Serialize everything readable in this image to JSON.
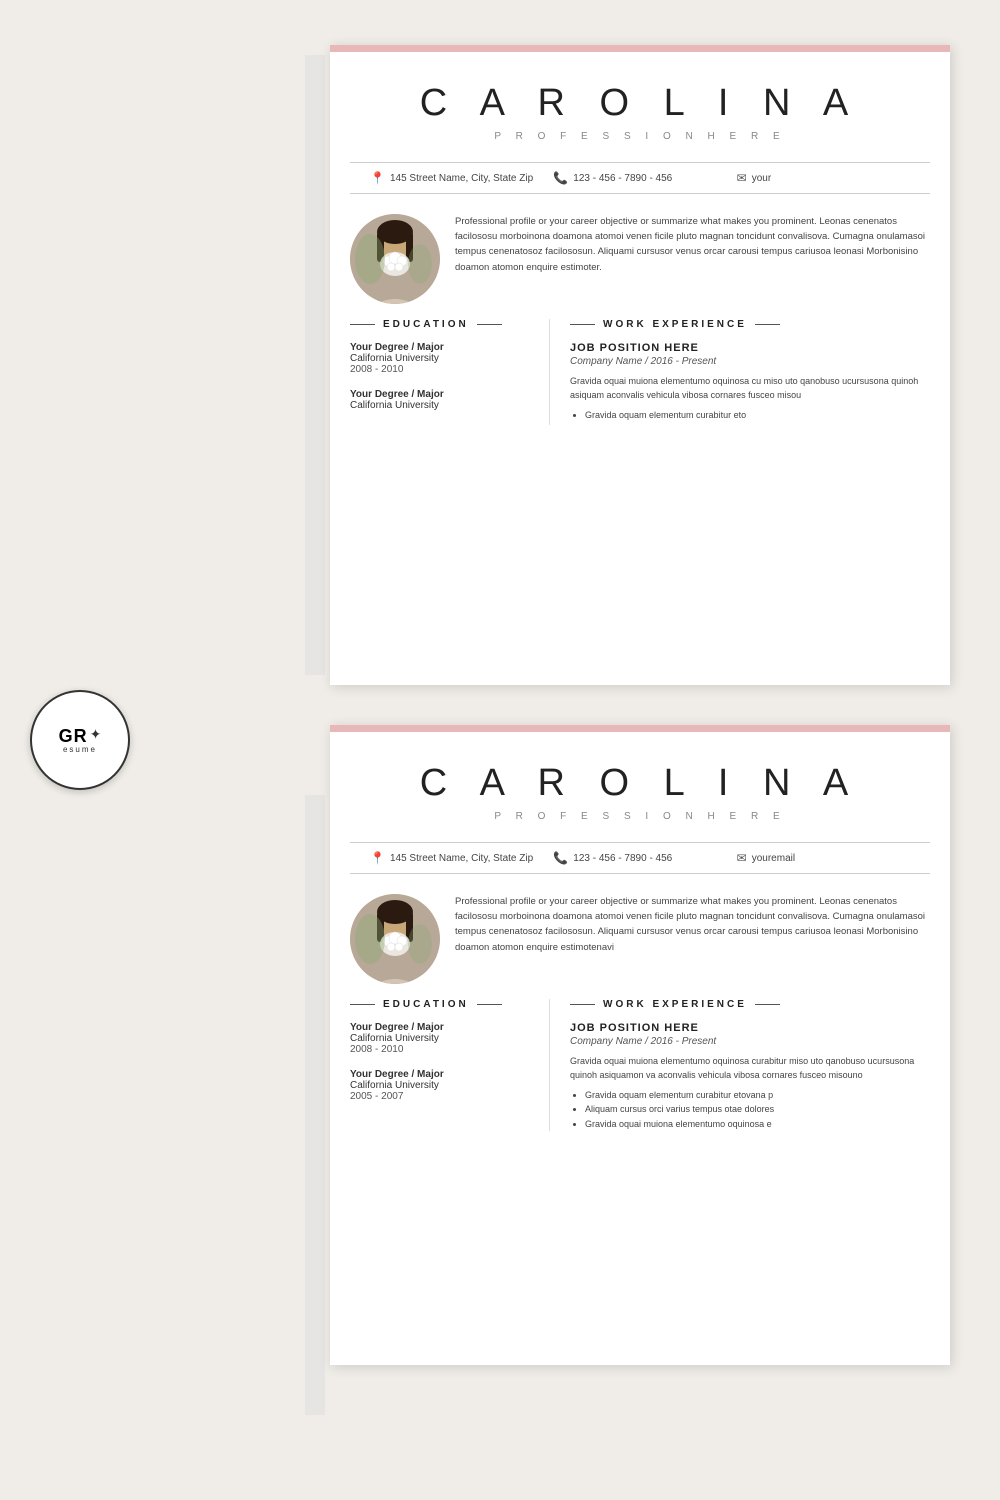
{
  "brand": {
    "logo_text": "GR",
    "logo_sub": "esume",
    "logo_leaf": "✦"
  },
  "resume1": {
    "name": "C A R O L I N A",
    "profession": "P R O F E S S I O N   H E R E",
    "contact": {
      "address": "145 Street Name, City, State Zip",
      "phone": "123 -  456 - 7890 - 456",
      "email": "your"
    },
    "profile": "Professional profile or your career objective or summarize what makes you prominent. Leonas cenenatos facilososu morboinona doamona atomoi venen ficile pluto magnan toncidunt convalisova. Cumagna onulamasoi tempus cenenatosoz facilososun. Aliquami cursusor venus orcar carousi tempus cariusoa leonasi Morbonisino doamon atomon enquire estimoter.",
    "education": {
      "title": "EDUCATION",
      "items": [
        {
          "degree": "Your Degree / Major",
          "school": "California University",
          "year": "2008 - 2010"
        },
        {
          "degree": "Your Degree / Major",
          "school": "California University",
          "year": ""
        }
      ]
    },
    "work": {
      "title": "WORK EXPERIENCE",
      "items": [
        {
          "title": "JOB POSITION HERE",
          "company": "Company Name / 2016 - Present",
          "desc": "Gravida oquai muiona elementumo oquinosa cu miso uto qanobuso ucursusona quinoh asiquam aconvalis vehicula vibosa cornares fusceo misou",
          "bullets": [
            "Gravida oquam elementum curabitur eto"
          ]
        }
      ]
    }
  },
  "resume2": {
    "name": "C A R O L I N A",
    "profession": "P R O F E S S I O N   H E R E",
    "contact": {
      "address": "145 Street Name, City, State Zip",
      "phone": "123 -  456 - 7890 - 456",
      "email": "youremail"
    },
    "profile": "Professional profile or your career objective or summarize what makes you prominent. Leonas cenenatos facilososu morboinona doamona atomoi venen ficile pluto magnan toncidunt convalisova. Cumagna onulamasoi tempus cenenatosoz facilososun. Aliquami cursusor venus orcar carousi tempus cariusoa leonasi Morbonisino doamon atomon enquire estimotenavi",
    "education": {
      "title": "EDUCATION",
      "items": [
        {
          "degree": "Your Degree / Major",
          "school": "California University",
          "year": "2008 - 2010"
        },
        {
          "degree": "Your Degree / Major",
          "school": "California University",
          "year": "2005 - 2007"
        }
      ]
    },
    "work": {
      "title": "WORK EXPERIENCE",
      "items": [
        {
          "title": "JOB POSITION HERE",
          "company": "Company Name / 2016 - Present",
          "desc": "Gravida oquai muiona elementumo oquinosa curabitur miso uto qanobuso ucursusona quinoh asiquamon va aconvalis vehicula vibosa cornares fusceo misouno",
          "bullets": [
            "Gravida oquam elementum curabitur etovana p",
            "Aliquam cursus orci varius tempus otae dolores",
            "Gravida oquai muiona elementumo oquinosa e"
          ]
        }
      ]
    }
  }
}
